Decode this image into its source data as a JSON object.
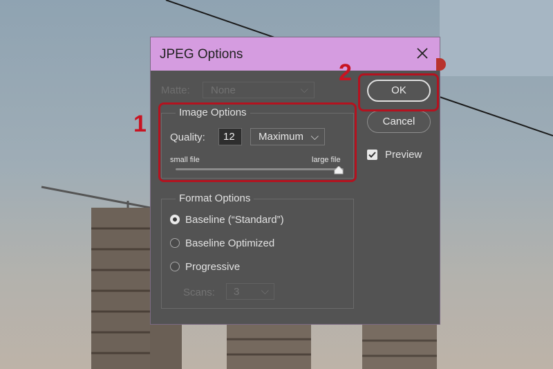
{
  "dialog": {
    "title": "JPEG Options",
    "close_icon": "close-x-icon"
  },
  "matte": {
    "label": "Matte:",
    "value": "None"
  },
  "image_options": {
    "group_title": "Image Options",
    "quality_label": "Quality:",
    "quality_value": "12",
    "quality_preset": "Maximum",
    "slider_min_label": "small file",
    "slider_max_label": "large file",
    "slider_level_percent": 100
  },
  "format_options": {
    "group_title": "Format Options",
    "options": [
      {
        "label": "Baseline (“Standard”)",
        "selected": true
      },
      {
        "label": "Baseline Optimized",
        "selected": false
      },
      {
        "label": "Progressive",
        "selected": false
      }
    ],
    "scans_label": "Scans:",
    "scans_value": "3"
  },
  "buttons": {
    "ok_label": "OK",
    "cancel_label": "Cancel"
  },
  "preview": {
    "label": "Preview",
    "checked": true
  },
  "annotations": {
    "step_1": "1",
    "step_2": "2",
    "color": "#c81422"
  },
  "colors": {
    "titlebar": "#d59ce0",
    "dialog_bg": "#535353"
  }
}
